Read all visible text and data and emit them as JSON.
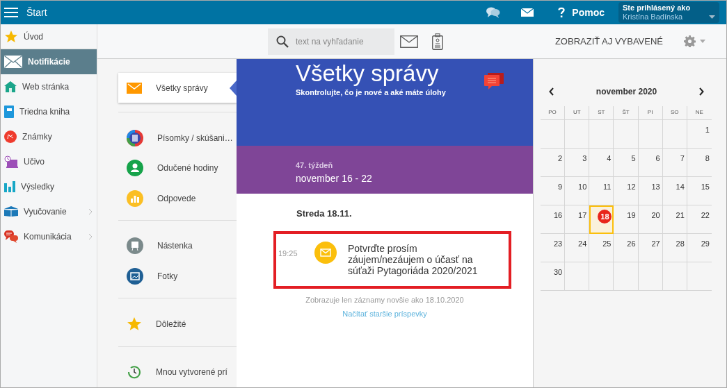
{
  "topbar": {
    "title": "Štart",
    "help": "Pomoc",
    "user_caption": "Ste prihlásený ako",
    "user_name": "Kristína Badínska"
  },
  "sidebar": {
    "items": [
      {
        "label": "Úvod",
        "selected": false,
        "has_submenu": false
      },
      {
        "label": "Notifikácie",
        "selected": true,
        "has_submenu": false
      },
      {
        "label": "Web stránka",
        "selected": false,
        "has_submenu": false
      },
      {
        "label": "Triedna kniha",
        "selected": false,
        "has_submenu": false
      },
      {
        "label": "Známky",
        "selected": false,
        "has_submenu": false
      },
      {
        "label": "Učivo",
        "selected": false,
        "has_submenu": false
      },
      {
        "label": "Výsledky",
        "selected": false,
        "has_submenu": false
      },
      {
        "label": "Vyučovanie",
        "selected": false,
        "has_submenu": true
      },
      {
        "label": "Komunikácia",
        "selected": false,
        "has_submenu": true
      }
    ]
  },
  "toolbar": {
    "search_placeholder": "text na vyhľadanie",
    "show_button": "ZOBRAZIŤ AJ VYBAVENÉ"
  },
  "categories": {
    "groups": [
      [
        {
          "label": "Všetky správy",
          "selected": true
        }
      ],
      [
        {
          "label": "Písomky / skúšani…",
          "selected": false
        },
        {
          "label": "Odučené hodiny",
          "selected": false
        },
        {
          "label": "Odpovede",
          "selected": false
        }
      ],
      [
        {
          "label": "Nástenka",
          "selected": false
        },
        {
          "label": "Fotky",
          "selected": false
        }
      ],
      [
        {
          "label": "Dôležité",
          "selected": false
        }
      ],
      [
        {
          "label": "Mnou vytvorené prí",
          "selected": false
        }
      ]
    ]
  },
  "feed": {
    "title": "Všetky správy",
    "subtitle": "Skontrolujte, čo je nové a aké máte úlohy",
    "week": "47. týždeň",
    "week_range": "november 16 - 22",
    "day_heading": "Streda 18.11.",
    "messages": [
      {
        "time": "19:25",
        "text": "Potvrďte prosím záujem/nezáujem o účasť na súťaži Pytagoriáda 2020/2021",
        "highlighted": true
      }
    ],
    "note": "Zobrazuje len záznamy novšie ako 18.10.2020",
    "load_older": "Načítať staršie príspevky"
  },
  "calendar": {
    "month": "november 2020",
    "weekdays": [
      "PO",
      "UT",
      "ST",
      "ŠT",
      "PI",
      "SO",
      "NE"
    ],
    "weeks": [
      [
        {
          "kind": "blank"
        },
        {
          "kind": "blank"
        },
        {
          "kind": "blank"
        },
        {
          "kind": "blank"
        },
        {
          "kind": "blank"
        },
        {
          "kind": "blank"
        },
        {
          "kind": "day",
          "day": "1",
          "selected": false
        }
      ],
      [
        {
          "kind": "day",
          "day": "2",
          "selected": false
        },
        {
          "kind": "day",
          "day": "3",
          "selected": false
        },
        {
          "kind": "day",
          "day": "4",
          "selected": false
        },
        {
          "kind": "day",
          "day": "5",
          "selected": false
        },
        {
          "kind": "day",
          "day": "6",
          "selected": false
        },
        {
          "kind": "day",
          "day": "7",
          "selected": false
        },
        {
          "kind": "day",
          "day": "8",
          "selected": false
        }
      ],
      [
        {
          "kind": "day",
          "day": "9",
          "selected": false
        },
        {
          "kind": "day",
          "day": "10",
          "selected": false
        },
        {
          "kind": "day",
          "day": "11",
          "selected": false
        },
        {
          "kind": "day",
          "day": "12",
          "selected": false
        },
        {
          "kind": "day",
          "day": "13",
          "selected": false
        },
        {
          "kind": "day",
          "day": "14",
          "selected": false
        },
        {
          "kind": "day",
          "day": "15",
          "selected": false
        }
      ],
      [
        {
          "kind": "day",
          "day": "16",
          "selected": false
        },
        {
          "kind": "day",
          "day": "17",
          "selected": false
        },
        {
          "kind": "day",
          "day": "18",
          "selected": true
        },
        {
          "kind": "day",
          "day": "19",
          "selected": false
        },
        {
          "kind": "day",
          "day": "20",
          "selected": false
        },
        {
          "kind": "day",
          "day": "21",
          "selected": false
        },
        {
          "kind": "day",
          "day": "22",
          "selected": false
        }
      ],
      [
        {
          "kind": "day",
          "day": "23",
          "selected": false
        },
        {
          "kind": "day",
          "day": "24",
          "selected": false
        },
        {
          "kind": "day",
          "day": "25",
          "selected": false
        },
        {
          "kind": "day",
          "day": "26",
          "selected": false
        },
        {
          "kind": "day",
          "day": "27",
          "selected": false
        },
        {
          "kind": "day",
          "day": "28",
          "selected": false
        },
        {
          "kind": "day",
          "day": "29",
          "selected": false
        }
      ],
      [
        {
          "kind": "day",
          "day": "30",
          "selected": false
        },
        {
          "kind": "blank"
        },
        {
          "kind": "blank"
        },
        {
          "kind": "blank"
        },
        {
          "kind": "blank"
        },
        {
          "kind": "blank"
        },
        {
          "kind": "blank"
        }
      ]
    ]
  }
}
